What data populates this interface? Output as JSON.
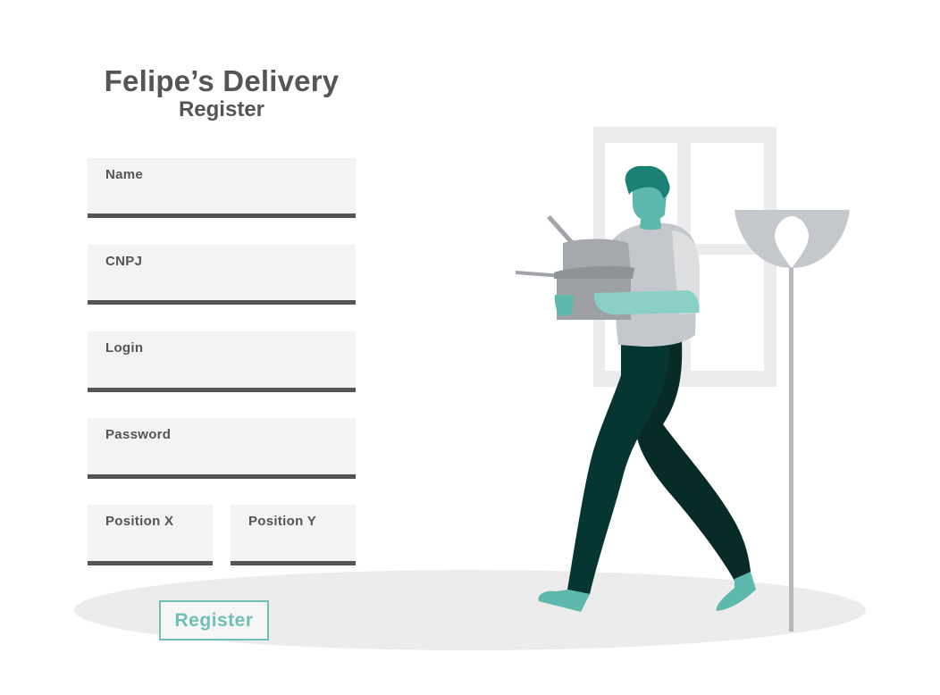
{
  "header": {
    "title": "Felipe’s Delivery",
    "subtitle": "Register"
  },
  "form": {
    "fields": {
      "name": {
        "label": "Name",
        "value": ""
      },
      "cnpj": {
        "label": "CNPJ",
        "value": ""
      },
      "login": {
        "label": "Login",
        "value": ""
      },
      "password": {
        "label": "Password",
        "value": ""
      },
      "position_x": {
        "label": "Position X",
        "value": ""
      },
      "position_y": {
        "label": "Position Y",
        "value": ""
      }
    },
    "submit_label": "Register"
  },
  "colors": {
    "text": "#555555",
    "field_background": "#f3f3f3",
    "field_underline": "#545454",
    "accent": "#6fbfb5"
  }
}
